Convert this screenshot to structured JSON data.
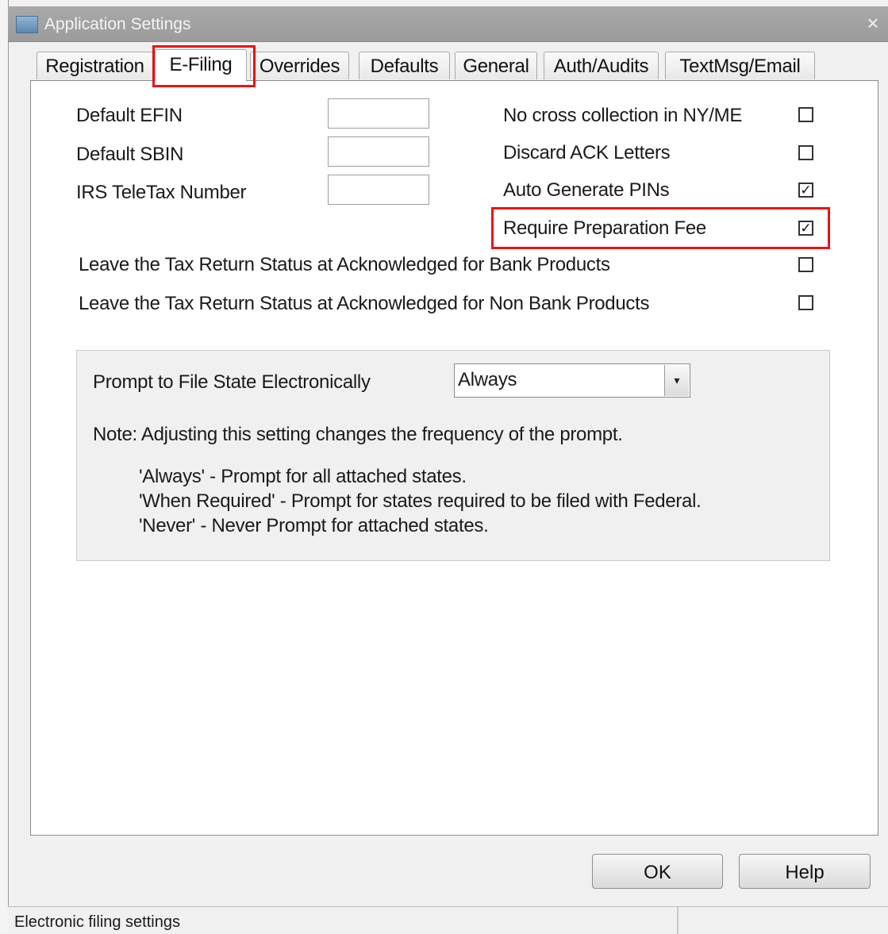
{
  "window": {
    "title": "Application Settings",
    "close_glyph": "×"
  },
  "tabs": [
    {
      "label": "Registration"
    },
    {
      "label": "E-Filing",
      "active": true
    },
    {
      "label": "Overrides"
    },
    {
      "label": "Defaults"
    },
    {
      "label": "General"
    },
    {
      "label": "Auth/Audits"
    },
    {
      "label": "TextMsg/Email"
    }
  ],
  "fields": {
    "default_efin": {
      "label": "Default EFIN",
      "value": ""
    },
    "default_sbin": {
      "label": "Default SBIN",
      "value": ""
    },
    "irs_teletax": {
      "label": "IRS TeleTax Number",
      "value": ""
    }
  },
  "options": {
    "no_cross_collection": {
      "label": "No cross collection in NY/ME",
      "checked": false
    },
    "discard_ack": {
      "label": "Discard ACK Letters",
      "checked": false
    },
    "auto_generate_pins": {
      "label": "Auto Generate PINs",
      "checked": true
    },
    "require_prep_fee": {
      "label": "Require Preparation Fee",
      "checked": true
    },
    "leave_status_bank": {
      "label": "Leave the Tax Return Status at Acknowledged for Bank Products",
      "checked": false
    },
    "leave_status_nonbank": {
      "label": "Leave the Tax Return Status at Acknowledged for Non Bank Products",
      "checked": false
    }
  },
  "state_prompt": {
    "label": "Prompt to File State Electronically",
    "selected": "Always",
    "arrow_glyph": "▾",
    "note": "Note: Adjusting this setting changes the frequency of the prompt.",
    "lines": [
      "'Always' - Prompt for all attached states.",
      "'When Required' - Prompt for states required to be filed with Federal.",
      "'Never' - Never Prompt for attached states."
    ]
  },
  "buttons": {
    "ok": "OK",
    "help": "Help"
  },
  "status": {
    "text": "Electronic filing settings"
  },
  "colors": {
    "highlight": "#ee1111",
    "titlebar": "#a0a0a0"
  },
  "icons": {
    "title": "app-icon",
    "close": "close-icon",
    "check": "checkmark-icon",
    "dropdown": "dropdown-arrow-icon"
  }
}
